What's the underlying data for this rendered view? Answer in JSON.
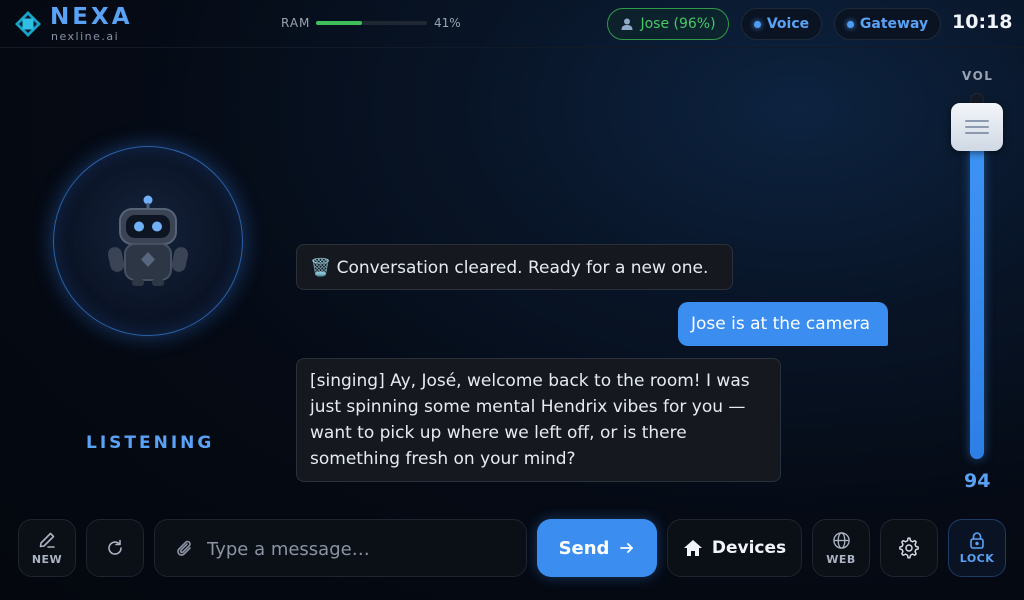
{
  "header": {
    "brand": "NEXA",
    "brand_sub": "nexline.ai",
    "ram_label": "RAM",
    "ram_percent_text": "41%",
    "ram_fraction": 0.41,
    "user_pill": "Jose (96%)",
    "voice_pill": "Voice",
    "gateway_pill": "Gateway",
    "clock": "10:18"
  },
  "avatar": {
    "status": "LISTENING"
  },
  "chat": {
    "messages": [
      {
        "role": "system",
        "text": "🗑️ Conversation cleared. Ready for a new one."
      },
      {
        "role": "user",
        "text": "Jose is at the camera"
      },
      {
        "role": "assistant",
        "text": "[singing] Ay, José, welcome back to the room! I was just spinning some mental Hendrix vibes for you — want to pick up where we left off, or is there something fresh on your mind?"
      }
    ]
  },
  "volume": {
    "label": "VOL",
    "value": "94",
    "fraction": 0.94
  },
  "toolbar": {
    "new_label": "NEW",
    "input_placeholder": "Type a message…",
    "send_label": "Send",
    "devices_label": "Devices",
    "web_label": "WEB",
    "lock_label": "LOCK"
  },
  "colors": {
    "accent": "#3b8ef0",
    "accent_text": "#5aa2f5",
    "success": "#49c668",
    "background": "#050a14"
  },
  "icons": [
    "nexa-logo-icon",
    "user-icon",
    "robot-icon",
    "pencil-icon",
    "refresh-icon",
    "paperclip-icon",
    "arrow-right-icon",
    "home-icon",
    "globe-icon",
    "gear-icon",
    "lock-icon"
  ]
}
